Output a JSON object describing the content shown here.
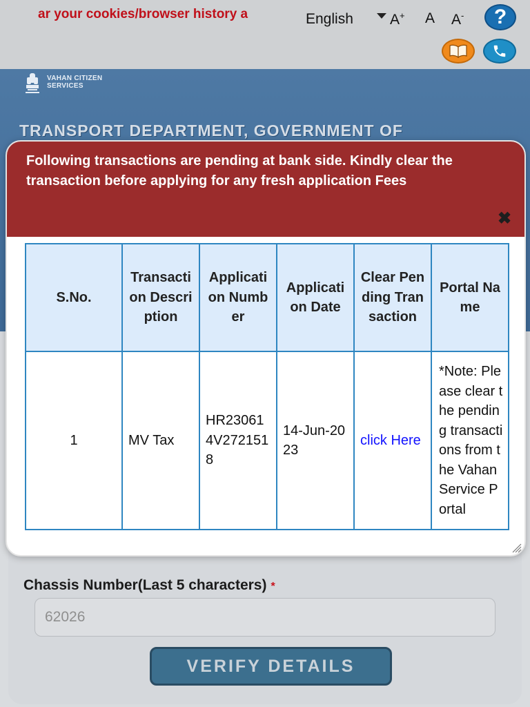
{
  "topbar": {
    "marquee": "ar your cookies/browser history a",
    "language": "English",
    "font_increase": "A",
    "font_increase_sup": "+",
    "font_normal": "A",
    "font_decrease": "A",
    "font_decrease_sup": "-",
    "help_label": "?"
  },
  "header": {
    "site_name_line1": "VAHAN CITIZEN",
    "site_name_line2": "SERVICES",
    "department": "TRANSPORT DEPARTMENT, GOVERNMENT OF"
  },
  "form": {
    "chassis_label": "Chassis Number(Last 5 characters)",
    "required_mark": "*",
    "chassis_value": "62026",
    "verify_button": "VERIFY DETAILS"
  },
  "modal": {
    "message": "Following transactions are pending at bank side. Kindly clear the transaction before applying for any fresh application Fees",
    "close_label": "✖",
    "table": {
      "headers": [
        "S.No.",
        "Transaction Description",
        "Application Number",
        "Application Date",
        "Clear Pending Transaction",
        "Portal Name"
      ],
      "rows": [
        {
          "sno": "1",
          "description": "MV Tax",
          "application_number": "HR230614V2721518",
          "application_date": "14-Jun-2023",
          "clear_link": "click Here",
          "portal_name": "*Note: Please clear the pending transactions from the Vahan Service Portal"
        }
      ]
    }
  },
  "colors": {
    "modal_header": "#9b2c2c",
    "table_border": "#2e86c1",
    "header_fill": "#dcebfb",
    "link": "#1212ff",
    "banner": "#4e79a4"
  }
}
